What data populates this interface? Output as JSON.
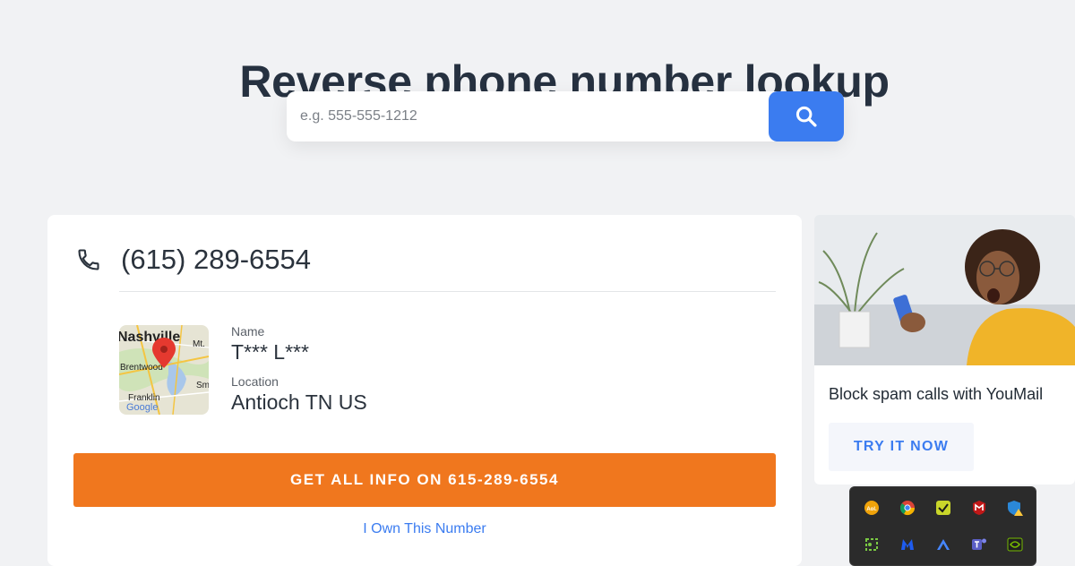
{
  "page": {
    "title": "Reverse phone number lookup"
  },
  "search": {
    "placeholder": "e.g. 555-555-1212",
    "value": "",
    "button_icon": "search-icon"
  },
  "result": {
    "phone_number": "(615) 289-6554",
    "phone_icon": "phone-icon",
    "map": {
      "labels": {
        "city": "Nashville",
        "mt": "Mt.",
        "brentwood": "Brentwood",
        "sm": "Sm",
        "franklin": "Franklin",
        "google": "Google"
      }
    },
    "name_label": "Name",
    "name_value": "T*** L***",
    "location_label": "Location",
    "location_value": "Antioch TN US",
    "cta_label": "GET ALL INFO ON 615-289-6554",
    "own_link": "I Own This Number"
  },
  "ad": {
    "headline": "Block spam calls with YouMail",
    "button_label": "TRY IT NOW"
  },
  "tray": {
    "icons": [
      "aol-icon",
      "chrome-icon",
      "security-check-icon",
      "mcafee-icon",
      "defender-warning-icon",
      "snip-tool-icon",
      "malwarebytes-icon",
      "nordvpn-icon",
      "teams-icon",
      "nvidia-icon"
    ],
    "aol_label": "Aol."
  },
  "colors": {
    "accent": "#3b7cf0",
    "cta": "#f0771e",
    "background": "#f1f2f4"
  }
}
